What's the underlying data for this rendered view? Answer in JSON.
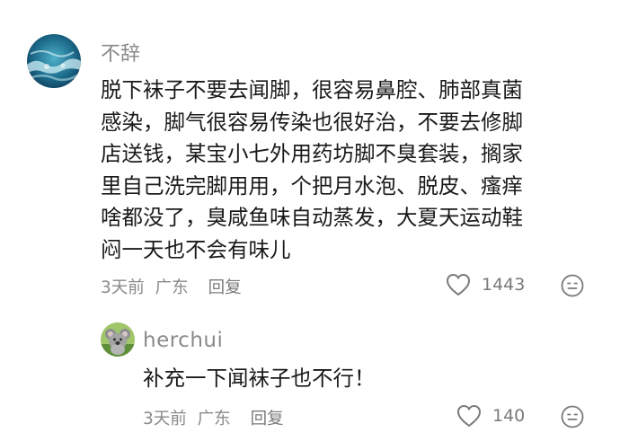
{
  "comments": [
    {
      "username": "不辞",
      "lines": [
        "脱下袜子不要去闻脚，很容易鼻腔、肺部真菌",
        "感染，脚气很容易传染也很好治，不要去修脚",
        "店送钱，某宝小七外用药坊脚不臭套装，搁家",
        "里自己洗完脚用用，个把月水泡、脱皮、瘙痒",
        "啥都没了，臭咸鱼味自动蒸发，大夏天运动鞋",
        "闷一天也不会有味儿"
      ],
      "time": "3天前",
      "location": "广东",
      "reply_label": "回复",
      "like_count": "1443",
      "avatar_icon": "ocean-wave-avatar",
      "like_icon": "heart-outline-icon",
      "emoji_icon": "smiley-face-icon"
    }
  ],
  "reply": {
    "username": "herchui",
    "text": "补充一下闻袜子也不行！",
    "time": "3天前",
    "location": "广东",
    "reply_label": "回复",
    "like_count": "140",
    "avatar_icon": "koala-avatar",
    "like_icon": "heart-outline-icon",
    "emoji_icon": "smiley-face-icon"
  },
  "colors": {
    "text": "#1a1a1a",
    "muted": "#8a8a8a",
    "icon": "#7a7a7a"
  }
}
